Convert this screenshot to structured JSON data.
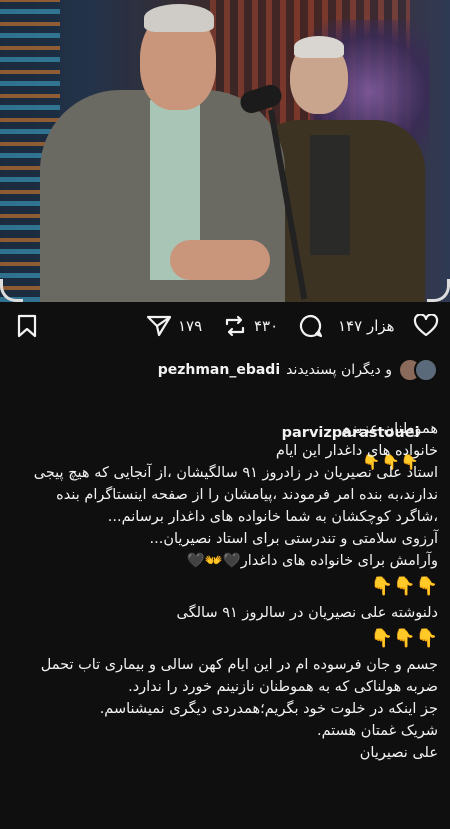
{
  "post": {
    "actions": {
      "likes": "۱۴۷ هزار",
      "comments": "۴۳۰",
      "reposts": "۱۷۹"
    },
    "liked_by": {
      "user": "pezhman_ebadi",
      "text": "و دیگران پسندیدند"
    },
    "caption": {
      "username": "parvizparastouei",
      "user_emojis": "👇👇👇",
      "lines": [
        "هموطنان عزیزم",
        "خانواده های داغدار این ایام",
        "استاد علی نصیریان در زادروز ۹۱ سالگیشان ،از آنجایی که هیچ پیجی ندارند،به بنده امر فرمودند ،پیامشان را از صفحه اینستاگرام بنده ،شاگرد کوچکشان به شما خانواده های داغدار برسانم...",
        "آرزوی سلامتی و تندرستی برای استاد نصیریان...",
        "وآرامش برای خانواده های داغدار🖤👐🖤"
      ],
      "emoji_row_1": "👇👇👇",
      "mid_line": "دلنوشته علی نصیریان در سالروز ۹۱ سالگی",
      "emoji_row_2": "👇👇👇",
      "lines2": [
        "جسم و جان فرسوده ام در این ایام کهن سالی و بیماری تاب تحمل ضربه هولناکی که به هموطنان نازنینم خورد را ندارد.",
        "جز اینکه در خلوت خود بگریم؛همدردی دیگری نمیشناسم.",
        "شریک غمتان هستم.",
        "علی نصیریان"
      ]
    }
  },
  "icons": [
    "bookmark-icon",
    "share-icon",
    "repost-icon",
    "comment-icon",
    "heart-icon"
  ]
}
